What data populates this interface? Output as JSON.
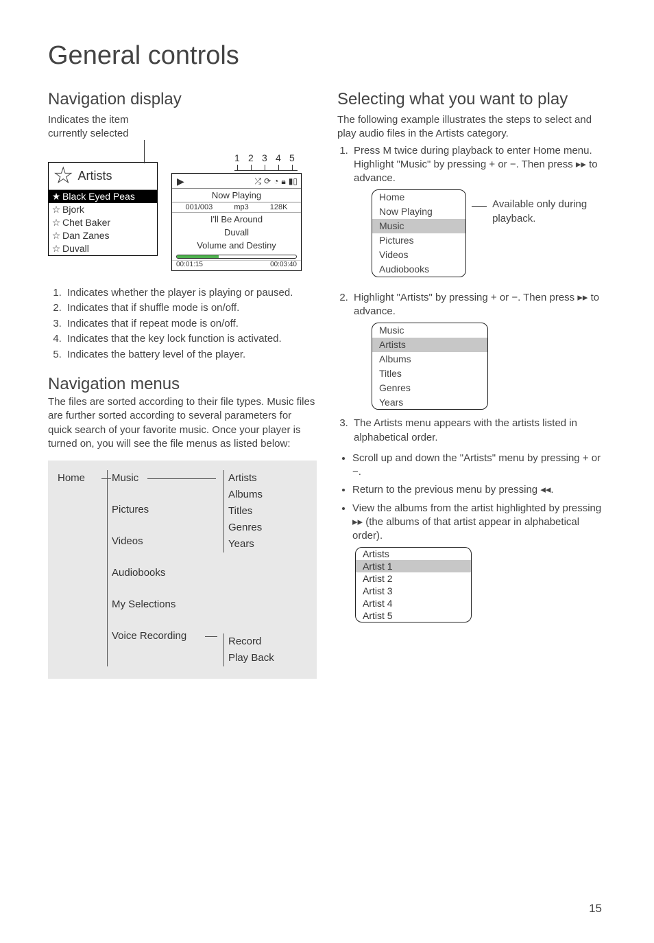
{
  "page_title": "General controls",
  "page_number": "15",
  "left": {
    "nav_display_h": "Navigation display",
    "indicates": "Indicates the item currently selected",
    "markers": [
      "1",
      "2",
      "3",
      "4",
      "5"
    ],
    "artists_header": "Artists",
    "artist_items": [
      {
        "name": "Black Eyed Peas",
        "fav": true,
        "sel": true
      },
      {
        "name": "Bjork",
        "fav": false,
        "sel": false
      },
      {
        "name": "Chet Baker",
        "fav": false,
        "sel": false
      },
      {
        "name": "Dan Zanes",
        "fav": false,
        "sel": false
      },
      {
        "name": "Duvall",
        "fav": false,
        "sel": false
      }
    ],
    "np": {
      "title": "Now Playing",
      "track_idx": "001/003",
      "codec": "mp3",
      "bitrate": "128K",
      "song": "I'll Be Around",
      "artist": "Duvall",
      "album": "Volume and Destiny",
      "elapsed": "00:01:15",
      "total": "00:03:40"
    },
    "legend": [
      "Indicates whether the player is playing or paused.",
      "Indicates that if shuffle mode is on/off.",
      "Indicates that if repeat mode is on/off.",
      "Indicates that the key lock function is activated.",
      "Indicates the battery level of the player."
    ],
    "nav_menus_h": "Navigation menus",
    "nav_menus_p": "The files are sorted according to their file types. Music files are further sorted according to several parameters for quick search of your favorite music. Once your player is turned on, you will see the file menus as listed below:",
    "tree": {
      "home": "Home",
      "c2": [
        "Music",
        "Pictures",
        "Videos",
        "Audiobooks",
        "My Selections",
        "Voice Recording"
      ],
      "c3a": [
        "Artists",
        "Albums",
        "Titles",
        "Genres",
        "Years"
      ],
      "c3b": [
        "Record",
        "Play Back"
      ]
    }
  },
  "right": {
    "h": "Selecting what you want to play",
    "intro": "The following example illustrates the steps to select and play audio files in the Artists category.",
    "step1": "Press M twice during playback to enter Home menu. Highlight \"Music\" by pressing + or −. Then press ▸▸ to advance.",
    "home_items": [
      "Home",
      "Now Playing",
      "Music",
      "Pictures",
      "Videos",
      "Audiobooks"
    ],
    "home_note": "Available only during playback.",
    "step2": "Highlight \"Artists\" by pressing + or −. Then press ▸▸ to advance.",
    "music_items": [
      "Music",
      "Artists",
      "Albums",
      "Titles",
      "Genres",
      "Years"
    ],
    "step3": "The Artists menu appears with the artists listed in alphabetical order.",
    "bullets": [
      "Scroll up and down the \"Artists\" menu by pressing + or −.",
      "Return to the previous menu by pressing ◂◂.",
      "View the albums from the artist highlighted by pressing ▸▸ (the albums of that artist appear in alphabetical order)."
    ],
    "artists_items": [
      "Artists",
      "Artist 1",
      "Artist 2",
      "Artist 3",
      "Artist 4",
      "Artist 5"
    ]
  }
}
